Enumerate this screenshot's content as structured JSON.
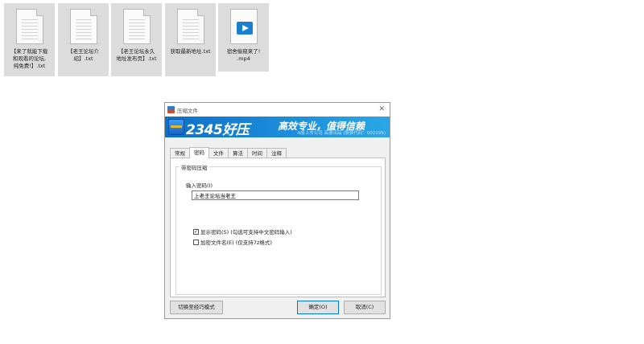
{
  "desktop": {
    "files": [
      {
        "name": "【来了就能下载\n和观看的论坛,\n纯免费!】.txt",
        "icon": "text-file-icon"
      },
      {
        "name": "【老王论坛介\n绍】.txt",
        "icon": "text-file-icon"
      },
      {
        "name": "【老王论坛永久\n地址发布页】.txt",
        "icon": "text-file-icon"
      },
      {
        "name": "获取最新地址.txt",
        "icon": "text-file-icon"
      },
      {
        "name": "宿舍偷窥来了!\n.mp4",
        "icon": "video-file-icon"
      }
    ]
  },
  "dialog": {
    "title": "压缩文件",
    "banner": {
      "brand": "2345好压",
      "slogan": "高效专业，值得信赖",
      "sub": "A股上市公司 高德出品 (股票代码：002195)"
    },
    "tabs": [
      "常规",
      "密码",
      "文件",
      "算法",
      "时间",
      "注释"
    ],
    "active_tab": "密码",
    "group_label": "带密码压缩",
    "password_label": "输入密码(I)",
    "password_value": "上老王论坛当老王",
    "show_password": {
      "label": "显示密码(S) (勾选可支持中文密码输入)",
      "checked": true
    },
    "encrypt_names": {
      "label": "加密文件名(E) (仅支持7z格式)",
      "checked": false
    },
    "buttons": {
      "switch_mode": "切换至经巧模式",
      "ok": "确定(O)",
      "cancel": "取消(C)"
    }
  }
}
